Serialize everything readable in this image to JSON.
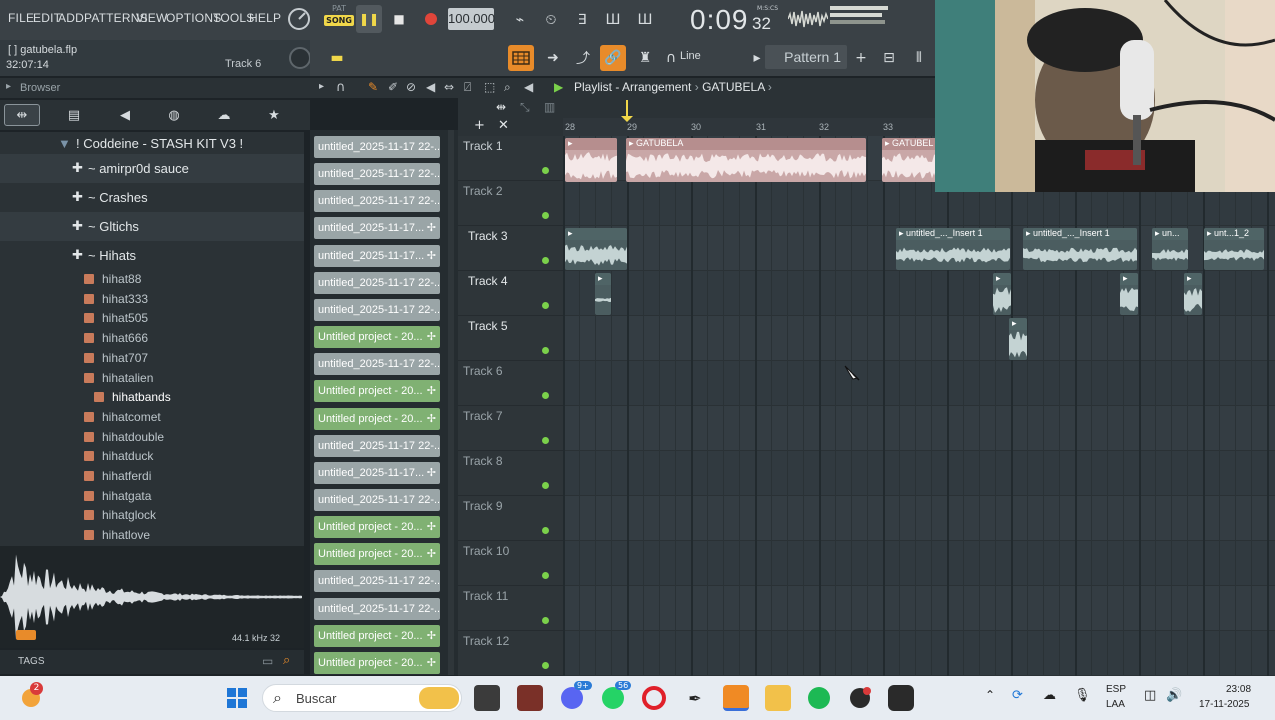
{
  "menu": [
    "FILE",
    "EDIT",
    "ADD",
    "PATTERNS",
    "VIEW",
    "OPTIONS",
    "TOOLS",
    "HELP"
  ],
  "transport": {
    "pat_label": "PAT",
    "song_label": "SONG",
    "tempo": "100.000",
    "time_main": "0:09",
    "time_sub": "32",
    "time_unit": "M:S:CS"
  },
  "project": {
    "name": "gatubela.flp",
    "bracket": "[ ]",
    "time": "32:07:14",
    "hint": "Track 6"
  },
  "toolbar": {
    "snap_mode": "Line",
    "pattern": "Pattern 1",
    "add": "+"
  },
  "browser": {
    "title": "Browser",
    "folders": [
      {
        "label": "! Coddeine - STASH KIT V3 !",
        "icon": "folder-icon"
      },
      {
        "label": "~ amirpr0d sauce",
        "icon": "plus-icon"
      },
      {
        "label": "~ Crashes",
        "icon": "plus-icon"
      },
      {
        "label": "~ Gltichs",
        "icon": "plus-icon"
      },
      {
        "label": "~ Hihats",
        "icon": "plus-icon"
      }
    ],
    "files": [
      "hihat88",
      "hihat333",
      "hihat505",
      "hihat666",
      "hihat707",
      "hihatalien",
      "hihatbands",
      "hihatcomet",
      "hihatdouble",
      "hihatduck",
      "hihatferdi",
      "hihatgata",
      "hihatglock",
      "hihatlove"
    ],
    "selected_file": "hihatbands",
    "sample_info": "44.1 kHz 32",
    "tags_label": "TAGS"
  },
  "clips": [
    {
      "label": "untitled_2025-11-17 22-...",
      "color": "grey",
      "wave": false
    },
    {
      "label": "untitled_2025-11-17 22-...",
      "color": "grey",
      "wave": false
    },
    {
      "label": "untitled_2025-11-17 22-...",
      "color": "grey",
      "wave": false
    },
    {
      "label": "untitled_2025-11-17...",
      "color": "grey",
      "wave": true
    },
    {
      "label": "untitled_2025-11-17...",
      "color": "grey",
      "wave": true
    },
    {
      "label": "untitled_2025-11-17 22-...",
      "color": "grey",
      "wave": false
    },
    {
      "label": "untitled_2025-11-17 22-...",
      "color": "grey",
      "wave": false
    },
    {
      "label": "Untitled project - 20...",
      "color": "green",
      "wave": true
    },
    {
      "label": "untitled_2025-11-17 22-...",
      "color": "grey",
      "wave": false
    },
    {
      "label": "Untitled project - 20...",
      "color": "green",
      "wave": true
    },
    {
      "label": "Untitled project - 20...",
      "color": "green",
      "wave": true
    },
    {
      "label": "untitled_2025-11-17 22-...",
      "color": "grey",
      "wave": false
    },
    {
      "label": "untitled_2025-11-17...",
      "color": "grey",
      "wave": true
    },
    {
      "label": "untitled_2025-11-17 22-...",
      "color": "grey",
      "wave": false
    },
    {
      "label": "Untitled project - 20...",
      "color": "green",
      "wave": true
    },
    {
      "label": "Untitled project - 20...",
      "color": "green",
      "wave": true
    },
    {
      "label": "untitled_2025-11-17 22-...",
      "color": "grey",
      "wave": false
    },
    {
      "label": "untitled_2025-11-17 22-...",
      "color": "grey",
      "wave": false
    },
    {
      "label": "Untitled project - 20...",
      "color": "green",
      "wave": true
    },
    {
      "label": "Untitled project - 20...",
      "color": "green",
      "wave": true
    }
  ],
  "playlist": {
    "title": "Playlist - Arrangement",
    "arrangement": "GATUBELA",
    "ruler": [
      "28",
      "29",
      "30",
      "31",
      "32",
      "33"
    ],
    "tracks": [
      "Track 1",
      "Track 2",
      "Track 3",
      "Track 4",
      "Track 5",
      "Track 6",
      "Track 7",
      "Track 8",
      "Track 9",
      "Track 10",
      "Track 11",
      "Track 12"
    ],
    "clip_labels": {
      "gatubela": "GATUBELA",
      "gatubela_short": "GATUBEL",
      "insert_a": "untitled_..._Insert 1",
      "insert_b": "untitled_..._Insert 1",
      "un": "un...",
      "unt": "unt...1_2"
    }
  },
  "taskbar": {
    "search_placeholder": "Buscar",
    "lang_top": "ESP",
    "lang_bottom": "LAA",
    "time": "23:08",
    "date": "17-11-2025",
    "badges": {
      "weather": "2",
      "discord": "9+",
      "whatsapp": "56"
    }
  }
}
